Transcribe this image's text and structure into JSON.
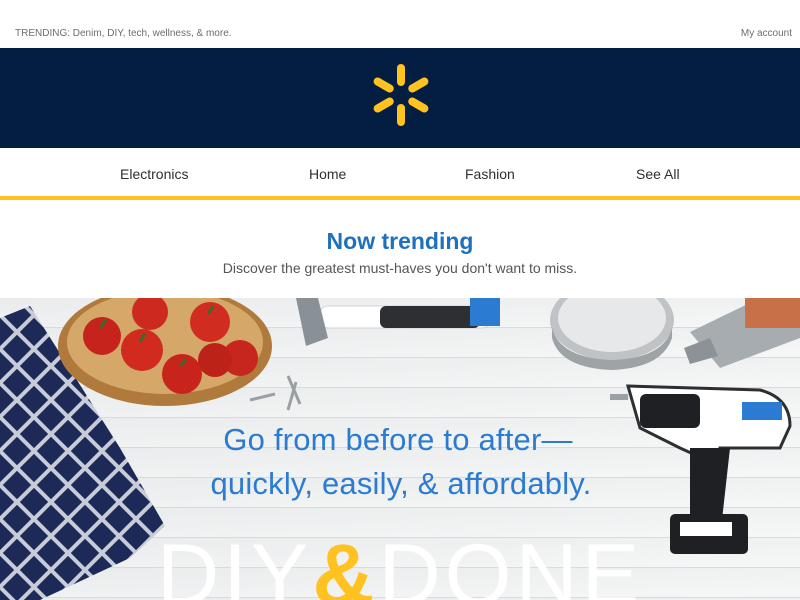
{
  "topbar": {
    "trending_text": "TRENDING: Denim, DIY, tech, wellness, & more.",
    "account_link": "My account"
  },
  "brand": {
    "logo_icon": "spark-logo-icon",
    "logo_color": "#ffc220",
    "bar_color": "#041e42"
  },
  "nav": {
    "items": [
      {
        "label": "Electronics"
      },
      {
        "label": "Home"
      },
      {
        "label": "Fashion"
      },
      {
        "label": "See All"
      }
    ],
    "accent_color": "#ffc220"
  },
  "section": {
    "title": "Now trending",
    "subtitle": "Discover the greatest must-haves you don't want to miss."
  },
  "hero": {
    "line1": "Go from before to after—",
    "line2": "quickly, easily, & affordably.",
    "brand_left": "DIY",
    "brand_amp": "&",
    "brand_right": "DONE",
    "headline_color": "#2a7bd1"
  }
}
